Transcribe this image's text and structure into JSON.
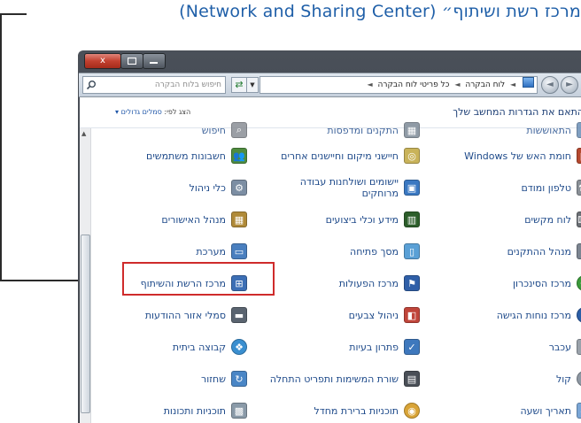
{
  "caption": {
    "text": "מרכז רשת ושיתוף״ (Network and Sharing Center)",
    "color": "#1f5fa8"
  },
  "window": {
    "title_buttons": {
      "close": "x"
    },
    "search": {
      "placeholder": "חיפוש בלוח הבקרה"
    },
    "address": {
      "crumbs": [
        "לוח הבקרה",
        "כל פריטי לוח הבקרה"
      ]
    }
  },
  "content": {
    "title": "התאם את הגדרות המחשב שלך",
    "view_by_label": "הצג לפי:",
    "view_by_value": "סמלים גדולים"
  },
  "items": {
    "top_clipped": [
      {
        "label": "התאוששות",
        "icon": "recovery-icon"
      },
      {
        "label": "התקנים ומדפסות",
        "icon": "devices-printers-icon"
      },
      {
        "label": "חיפוש",
        "icon": "search-options-icon"
      }
    ],
    "rows": [
      [
        "חומת האש של Windows",
        "חיישני מיקום וחיישנים אחרים",
        "חשבונות משתמשים"
      ],
      [
        "טלפון ומודם",
        "יישומים ושולחנות עבודה מרוחקים",
        "כלי ניהול"
      ],
      [
        "לוח מקשים",
        "מידע וכלי ביצועים",
        "מנהל האישורים"
      ],
      [
        "מנהל ההתקנים",
        "מסך פתיחה",
        "מערכת"
      ],
      [
        "מרכז הסינכרון",
        "מרכז הפעולות",
        "מרכז הרשת והשיתוף"
      ],
      [
        "מרכז נוחות הגישה",
        "ניהול צבעים",
        "סמלי אזור ההודעות"
      ],
      [
        "עכבר",
        "פתרון בעיות",
        "קבוצה ביתית"
      ],
      [
        "קול",
        "שורת המשימות ותפריט התחלה",
        "שחזור"
      ],
      [
        "תאריך ושעה",
        "תוכניות ברירת מחדל",
        "תוכניות ותכונות"
      ]
    ],
    "icons": [
      [
        "firewall-icon",
        "location-sensors-icon",
        "user-accounts-icon"
      ],
      [
        "phone-modem-icon",
        "remote-desktop-icon",
        "admin-tools-icon"
      ],
      [
        "keyboard-icon",
        "performance-icon",
        "credential-manager-icon"
      ],
      [
        "device-manager-icon",
        "start-screen-icon",
        "system-icon"
      ],
      [
        "sync-center-icon",
        "action-center-flag-icon",
        "network-sharing-icon"
      ],
      [
        "ease-of-access-icon",
        "color-management-icon",
        "notification-icons-icon"
      ],
      [
        "mouse-icon",
        "troubleshooting-icon",
        "homegroup-icon"
      ],
      [
        "sound-icon",
        "taskbar-start-icon",
        "restore-icon"
      ],
      [
        "date-time-icon",
        "default-programs-icon",
        "programs-features-icon"
      ]
    ]
  },
  "highlight": {
    "color": "#cf2b2b",
    "target": "מרכז הרשת והשיתוף"
  }
}
